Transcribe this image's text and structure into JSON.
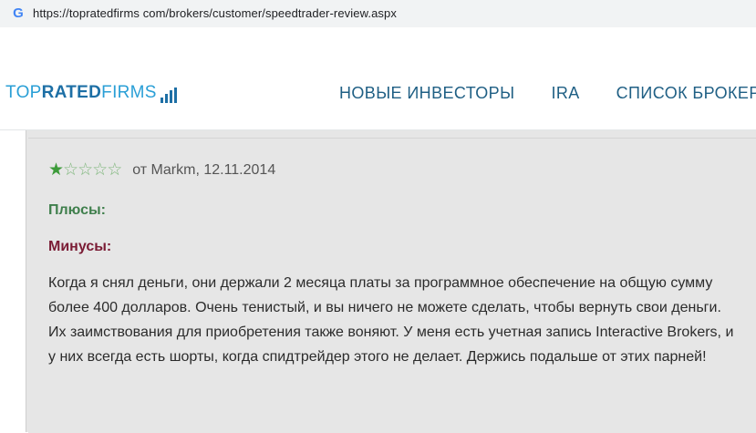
{
  "browser": {
    "url": "https://topratedfirms com/brokers/customer/speedtrader-review.aspx",
    "favicon": "google-icon"
  },
  "site": {
    "logo": {
      "part1": "TOP",
      "part2": "RATED",
      "part3": "FIRMS",
      "icon": "bar-chart-icon"
    },
    "nav": [
      {
        "label": "НОВЫЕ ИНВЕСТОРЫ"
      },
      {
        "label": "IRA"
      },
      {
        "label": "СПИСОК БРОКЕРОВ"
      }
    ]
  },
  "review": {
    "rating": 1,
    "rating_max": 5,
    "author_line": "от Markm, 12.11.2014",
    "pros_label": "Плюсы:",
    "cons_label": "Минусы:",
    "text": "Когда я снял деньги, они держали 2 месяца платы за программное обеспечение на общую сумму более 400 долларов. Очень тенистый, и вы ничего не можете сделать, чтобы вернуть свои деньги. Их заимствования для приобретения также воняют. У меня есть учетная запись Interactive Brokers, и у них всегда есть шорты, когда спидтрейдер этого не делает. Держись подальше от этих парней!"
  },
  "colors": {
    "pros": "#3f7f4c",
    "cons": "#7a1b34",
    "nav": "#1f5f84",
    "star": "#3d9b3a"
  }
}
